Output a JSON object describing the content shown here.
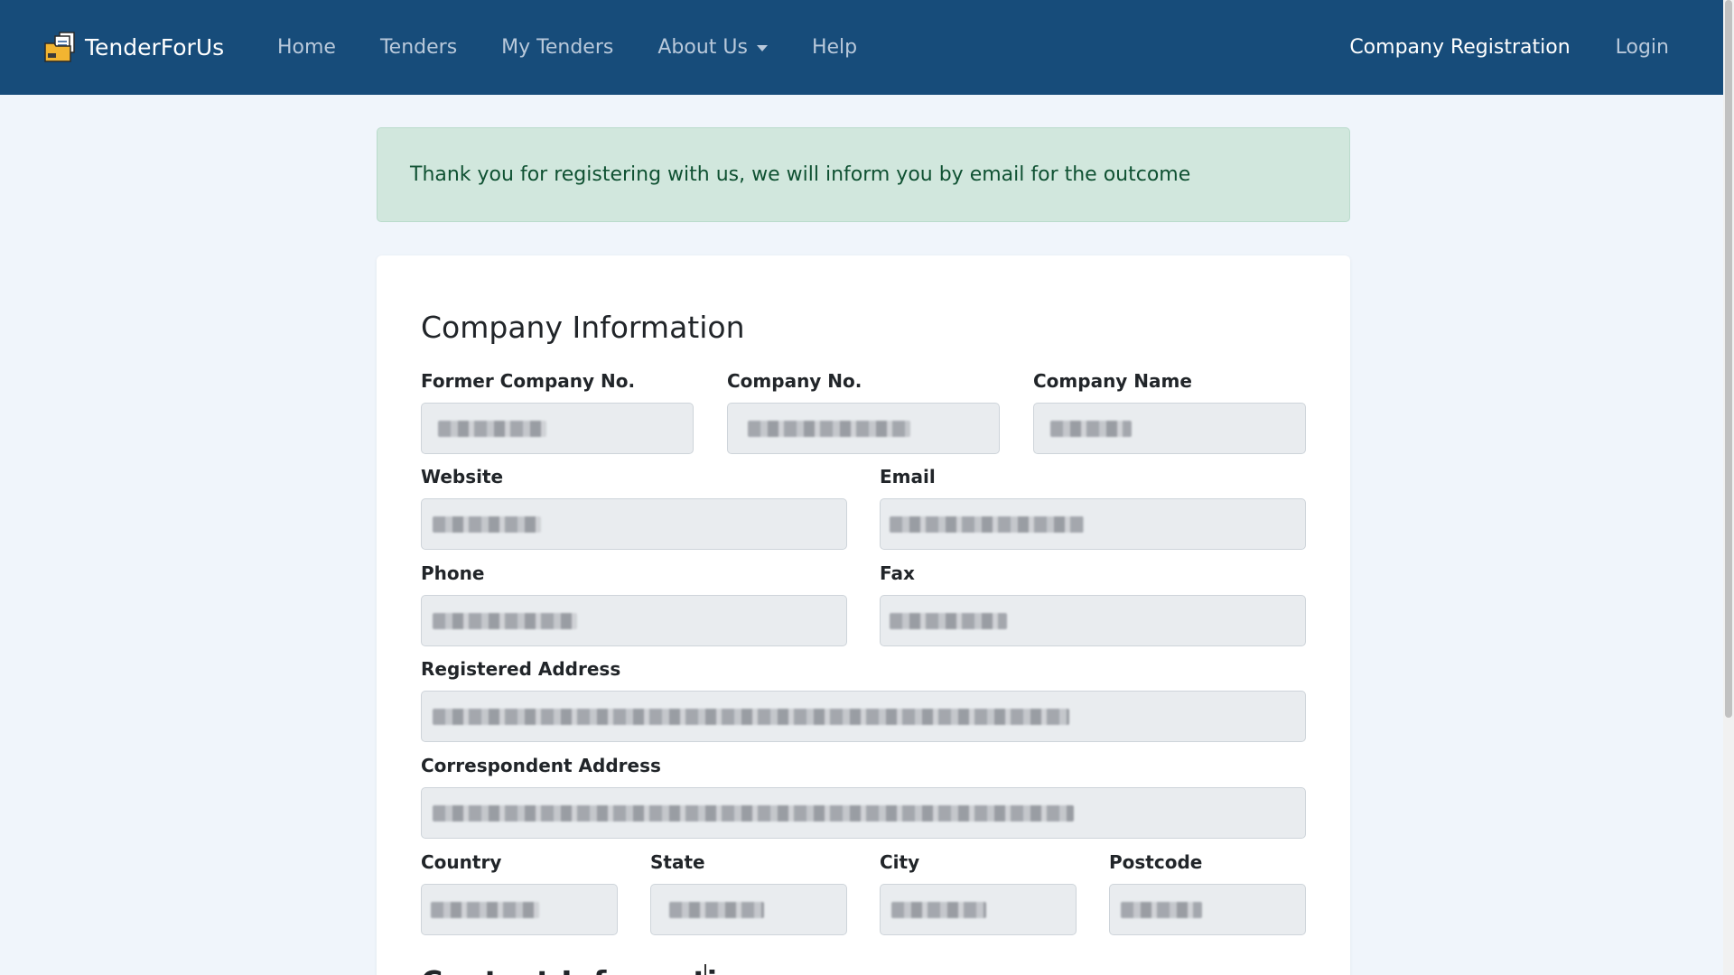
{
  "navbar": {
    "brand": "TenderForUs",
    "links": {
      "home": "Home",
      "tenders": "Tenders",
      "my_tenders": "My Tenders",
      "about": "About Us",
      "help": "Help"
    },
    "right": {
      "registration": "Company Registration",
      "login": "Login"
    }
  },
  "alert": {
    "message": "Thank you for registering with us, we will inform you by email for the outcome"
  },
  "company": {
    "title": "Company Information",
    "former_company_no": {
      "label": "Former Company No.",
      "value": ""
    },
    "company_no": {
      "label": "Company No.",
      "value": ""
    },
    "company_name": {
      "label": "Company Name",
      "value": ""
    },
    "website": {
      "label": "Website",
      "value": ""
    },
    "email": {
      "label": "Email",
      "value": ""
    },
    "phone": {
      "label": "Phone",
      "value": ""
    },
    "fax": {
      "label": "Fax",
      "value": ""
    },
    "registered_address": {
      "label": "Registered Address",
      "value": ""
    },
    "correspondent_address": {
      "label": "Correspondent Address",
      "value": ""
    },
    "country": {
      "label": "Country",
      "value": ""
    },
    "state": {
      "label": "State",
      "value": ""
    },
    "city": {
      "label": "City",
      "value": ""
    },
    "postcode": {
      "label": "Postcode",
      "value": ""
    }
  },
  "contact": {
    "title": "Contact Information"
  },
  "colors": {
    "navbar": "#174c7a",
    "alert_bg": "#d1e7dd",
    "alert_text": "#0f5132",
    "input_bg": "#e9ecef",
    "page_bg": "#f0f5fb"
  },
  "icons": {
    "brand": "folder-documents-icon",
    "dropdown": "caret-down-icon"
  }
}
